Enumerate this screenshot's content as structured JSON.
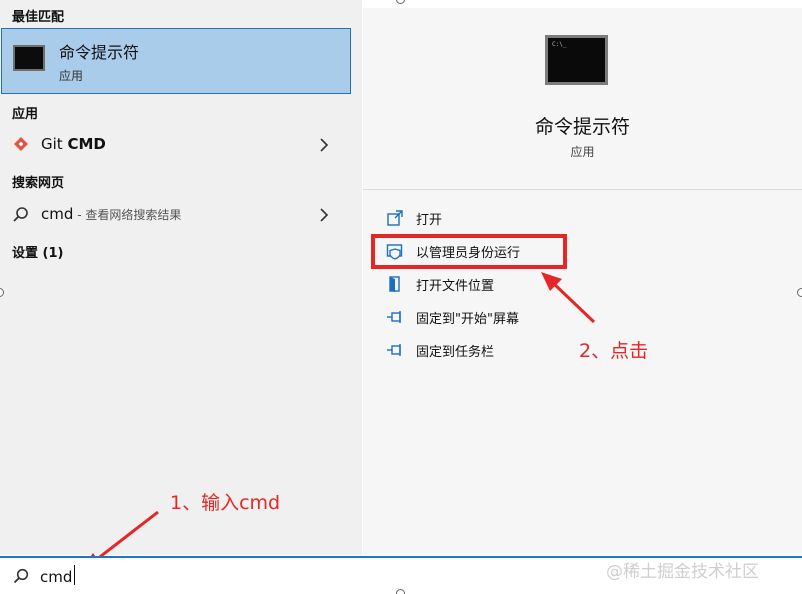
{
  "sections": {
    "best_match": "最佳匹配",
    "apps": "应用",
    "web_search": "搜索网页",
    "settings": "设置 (1)"
  },
  "best_match": {
    "name": "命令提示符",
    "type": "应用"
  },
  "apps": [
    {
      "name_prefix": "Git ",
      "name_bold": "CMD"
    }
  ],
  "web_search": {
    "query": "cmd",
    "hint": " - 查看网络搜索结果"
  },
  "preview": {
    "name": "命令提示符",
    "type": "应用",
    "icon": "terminal-icon",
    "icon_text": "C:\\_"
  },
  "actions": [
    {
      "label": "打开",
      "icon": "open-icon"
    },
    {
      "label": "以管理员身份运行",
      "icon": "shield-admin-icon"
    },
    {
      "label": "打开文件位置",
      "icon": "folder-icon"
    },
    {
      "label": "固定到\"开始\"屏幕",
      "icon": "pin-icon"
    },
    {
      "label": "固定到任务栏",
      "icon": "pin-icon"
    }
  ],
  "annotations": {
    "step1": "1、输入cmd",
    "step2": "2、点击"
  },
  "search": {
    "value": "cmd"
  },
  "watermark": "@稀土掘金技术社区",
  "colors": {
    "selection": "#a8ccea",
    "accent": "#1a76d0",
    "annotation_red": "#e52626"
  }
}
